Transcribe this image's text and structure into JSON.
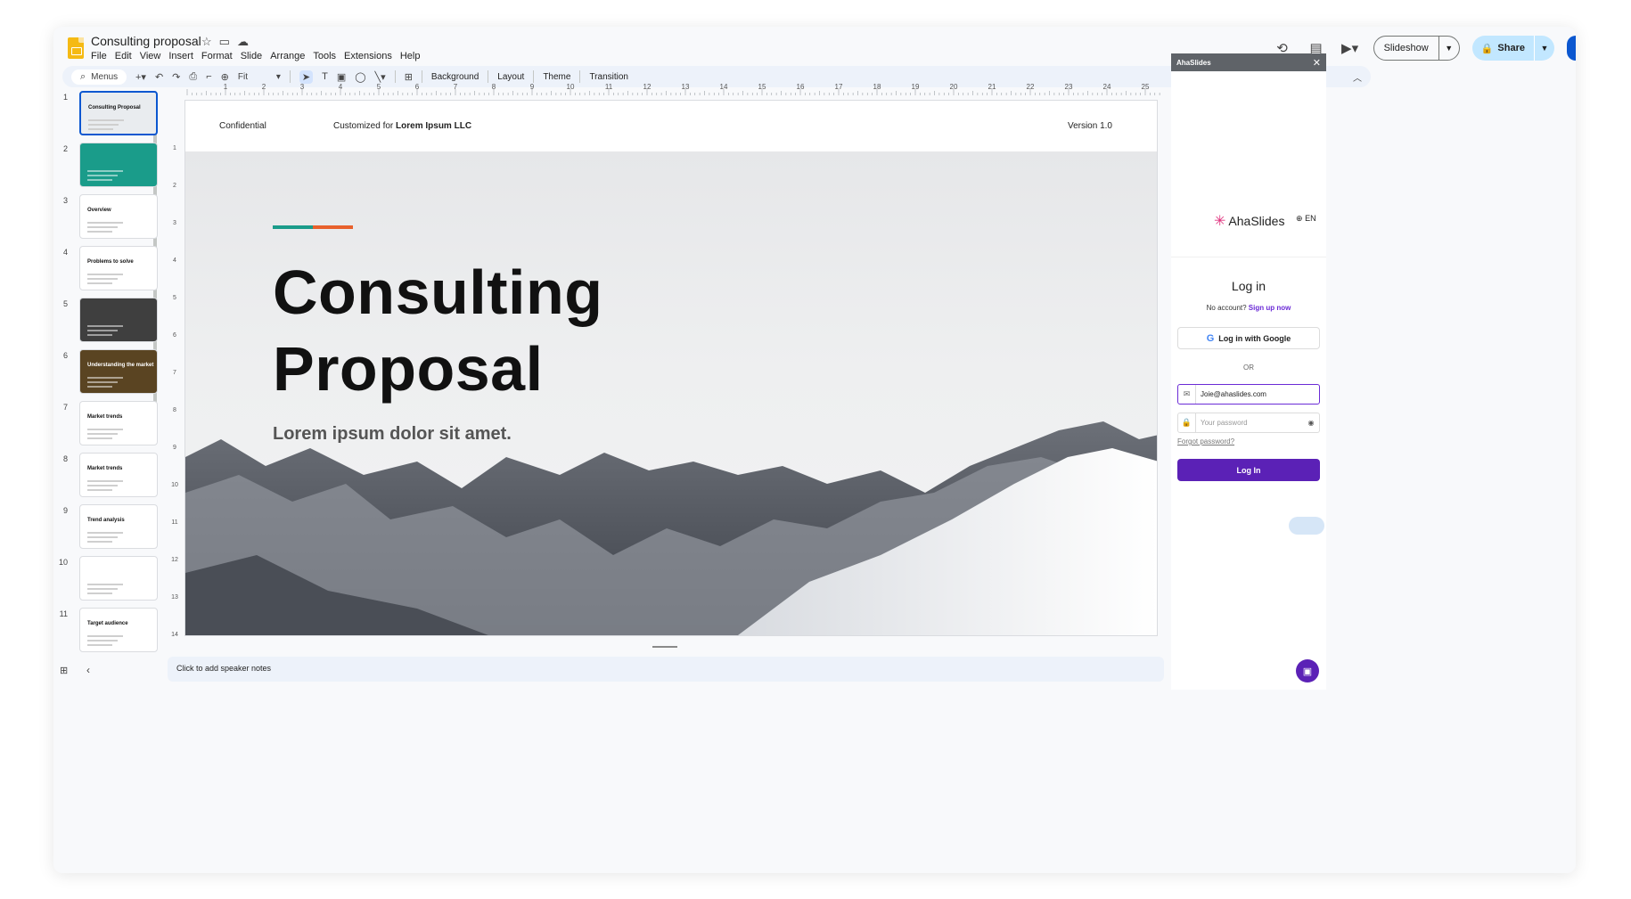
{
  "app": {
    "title": "Consulting proposal",
    "menus": [
      "File",
      "Edit",
      "View",
      "Insert",
      "Format",
      "Slide",
      "Arrange",
      "Tools",
      "Extensions",
      "Help"
    ],
    "header_buttons": {
      "slideshow": "Slideshow",
      "share": "Share"
    }
  },
  "toolbar": {
    "search_label": "Menus",
    "zoom": "Fit",
    "background": "Background",
    "layout": "Layout",
    "theme": "Theme",
    "transition": "Transition"
  },
  "filmstrip": {
    "slides": [
      {
        "num": "1",
        "title": "Consulting Proposal",
        "bg": "#e9ecef"
      },
      {
        "num": "2",
        "title": "",
        "bg": "#1a9c8a"
      },
      {
        "num": "3",
        "title": "Overview",
        "bg": "#ffffff"
      },
      {
        "num": "4",
        "title": "Problems to solve",
        "bg": "#ffffff"
      },
      {
        "num": "5",
        "title": "",
        "bg": "#3f3f3f"
      },
      {
        "num": "6",
        "title": "Understanding the market",
        "bg": "#5a4422"
      },
      {
        "num": "7",
        "title": "Market trends",
        "bg": "#ffffff"
      },
      {
        "num": "8",
        "title": "Market trends",
        "bg": "#ffffff"
      },
      {
        "num": "9",
        "title": "Trend analysis",
        "bg": "#ffffff"
      },
      {
        "num": "10",
        "title": "",
        "bg": "#ffffff"
      },
      {
        "num": "11",
        "title": "Target audience",
        "bg": "#ffffff"
      }
    ]
  },
  "ruler": {
    "labels": [
      "1",
      "2",
      "3",
      "4",
      "5",
      "6",
      "7",
      "8",
      "9",
      "10",
      "11",
      "12",
      "13",
      "14",
      "15",
      "16",
      "17",
      "18",
      "19",
      "20",
      "21",
      "22",
      "23",
      "24",
      "25"
    ],
    "vertical_labels": [
      "1",
      "2",
      "3",
      "4",
      "5",
      "6",
      "7",
      "8",
      "9",
      "10",
      "11",
      "12",
      "13",
      "14"
    ]
  },
  "slide": {
    "confidential": "Confidential",
    "customized_prefix": "Customized for",
    "customized_company": "Lorem Ipsum LLC",
    "version": "Version 1.0",
    "title_line1": "Consulting",
    "title_line2": "Proposal",
    "subtitle": "Lorem ipsum dolor sit amet.",
    "accent_colors": [
      "#1a9c8a",
      "#e8612c"
    ]
  },
  "notes": {
    "placeholder": "Click to add speaker notes"
  },
  "panel": {
    "header": "AhaSlides",
    "brand": "AhaSlides",
    "language": "EN",
    "login_title": "Log in",
    "no_account": "No account?",
    "signup": "Sign up now",
    "google_button": "Log in with Google",
    "or": "OR",
    "email_value": "Joie@ahaslides.com",
    "password_placeholder": "Your password",
    "forgot": "Forgot password?",
    "login_button": "Log In",
    "brand_color": "#5b21b6"
  }
}
